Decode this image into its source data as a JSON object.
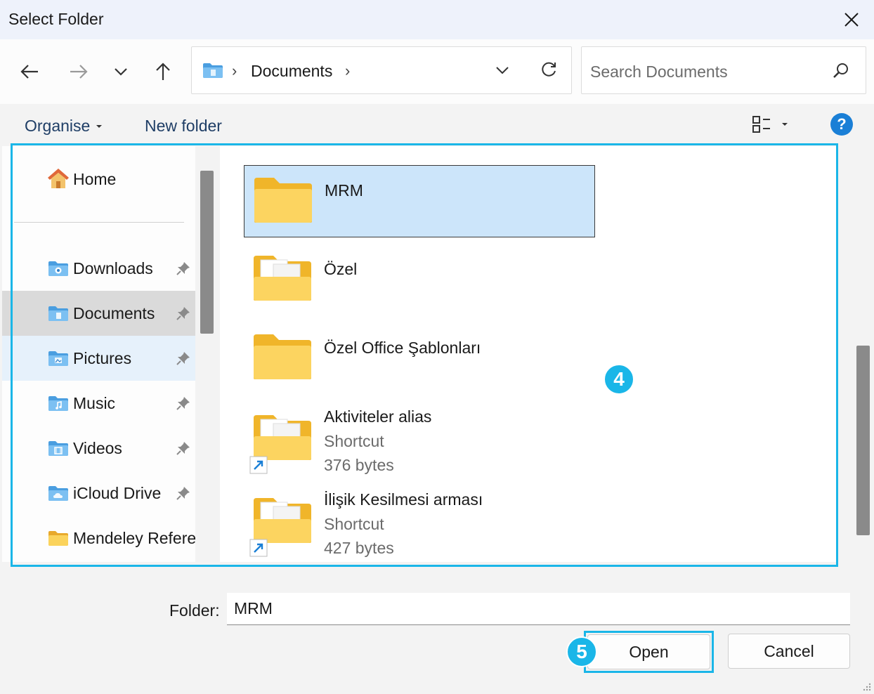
{
  "window": {
    "title": "Select Folder"
  },
  "address": {
    "breadcrumb": "Documents"
  },
  "search": {
    "placeholder": "Search Documents"
  },
  "toolbar": {
    "organise_label": "Organise",
    "new_folder_label": "New folder",
    "help_label": "?"
  },
  "nav": {
    "home_label": "Home",
    "items": [
      {
        "label": "Downloads",
        "icon": "downloads-folder-icon",
        "pinned": true
      },
      {
        "label": "Documents",
        "icon": "documents-folder-icon",
        "pinned": true,
        "selected": true
      },
      {
        "label": "Pictures",
        "icon": "pictures-folder-icon",
        "pinned": true,
        "hover": true
      },
      {
        "label": "Music",
        "icon": "music-folder-icon",
        "pinned": true
      },
      {
        "label": "Videos",
        "icon": "videos-folder-icon",
        "pinned": true
      },
      {
        "label": "iCloud Drive",
        "icon": "icloud-folder-icon",
        "pinned": true
      },
      {
        "label": "Mendeley Refere",
        "icon": "folder-icon",
        "pinned": false
      }
    ]
  },
  "content": {
    "items": [
      {
        "name": "MRM",
        "type": "folder",
        "selected": true
      },
      {
        "name": "Özel",
        "type": "folder"
      },
      {
        "name": "Özel Office Şablonları",
        "type": "folder"
      },
      {
        "name": "Aktiviteler alias",
        "type": "Shortcut",
        "size": "376 bytes"
      },
      {
        "name": "İlişik Kesilmesi arması",
        "type": "Shortcut",
        "size": "427 bytes"
      }
    ]
  },
  "annotations": {
    "badge_4": "4",
    "badge_5": "5"
  },
  "footer": {
    "folder_label": "Folder:",
    "folder_value": "MRM",
    "open_label": "Open",
    "cancel_label": "Cancel"
  },
  "colors": {
    "accent": "#1ab6e8",
    "selection": "#cce5fa",
    "folder": "#f8c64a",
    "help": "#1a7fd6"
  }
}
